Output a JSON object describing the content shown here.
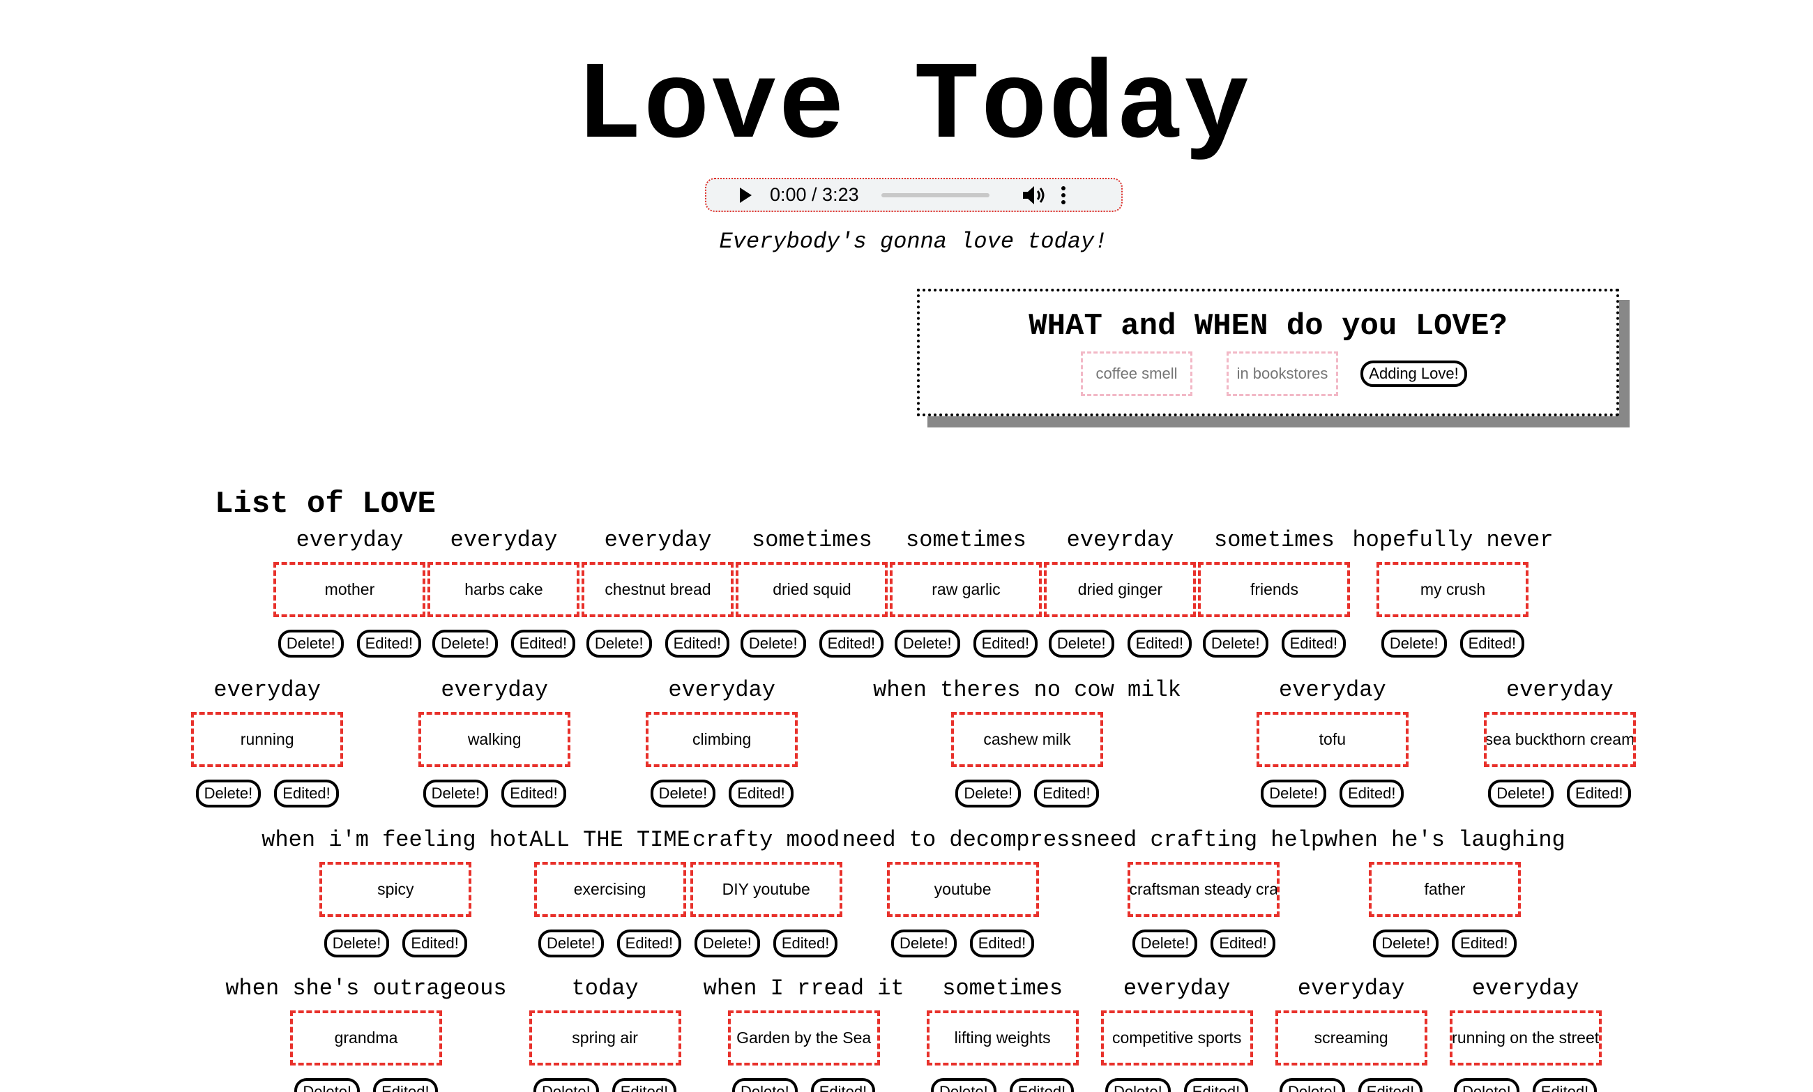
{
  "header": {
    "title": "Love Today",
    "subtitle": "Everybody's gonna love today!"
  },
  "audio_player": {
    "time_display": "0:00 / 3:23",
    "progress_fraction": 0,
    "play_icon": "play-icon",
    "volume_icon": "volume-icon",
    "more_icon": "more-options-icon"
  },
  "add_form": {
    "heading": "WHAT and WHEN do you LOVE?",
    "what_placeholder": "coffee smell",
    "when_placeholder": "in bookstores",
    "submit_label": "Adding Love!"
  },
  "list": {
    "title": "List of LOVE",
    "delete_label": "Delete!",
    "edit_label": "Edited!",
    "rows": [
      [
        {
          "when": "everyday",
          "what": "mother"
        },
        {
          "when": "everyday",
          "what": "harbs cake"
        },
        {
          "when": "everyday",
          "what": "chestnut bread"
        },
        {
          "when": "sometimes",
          "what": "dried squid"
        },
        {
          "when": "sometimes",
          "what": "raw garlic"
        },
        {
          "when": "eveyrday",
          "what": "dried ginger"
        },
        {
          "when": "sometimes",
          "what": "friends"
        },
        {
          "when": "hopefully never",
          "what": "my crush"
        }
      ],
      [
        {
          "when": "everyday",
          "what": "running"
        },
        {
          "when": "everyday",
          "what": "walking"
        },
        {
          "when": "everyday",
          "what": "climbing"
        },
        {
          "when": "when theres no cow milk",
          "what": "cashew milk"
        },
        {
          "when": "everyday",
          "what": "tofu"
        },
        {
          "when": "everyday",
          "what": "sea buckthorn cream"
        }
      ],
      [
        {
          "when": "when i'm feeling hot",
          "what": "spicy"
        },
        {
          "when": "ALL THE TIME",
          "what": "exercising"
        },
        {
          "when": "crafty mood",
          "what": "DIY youtube"
        },
        {
          "when": "need to decompress",
          "what": "youtube"
        },
        {
          "when": "need crafting help",
          "what": "craftsman steady cra"
        },
        {
          "when": "when he's laughing",
          "what": "father"
        }
      ],
      [
        {
          "when": "when she's outrageous",
          "what": "grandma"
        },
        {
          "when": "today",
          "what": "spring air"
        },
        {
          "when": "when I rread it",
          "what": "Garden by the Sea"
        },
        {
          "when": "sometimes",
          "what": "lifting weights"
        },
        {
          "when": "everyday",
          "what": "competitive sports"
        },
        {
          "when": "everyday",
          "what": "screaming"
        },
        {
          "when": "everyday",
          "what": "running on the street"
        }
      ]
    ]
  },
  "colors": {
    "item_border": "#e8312b",
    "input_border": "#f2b8c6",
    "panel_shadow": "#888888",
    "audio_border": "#e0302a",
    "audio_background": "#f1f3f4"
  }
}
